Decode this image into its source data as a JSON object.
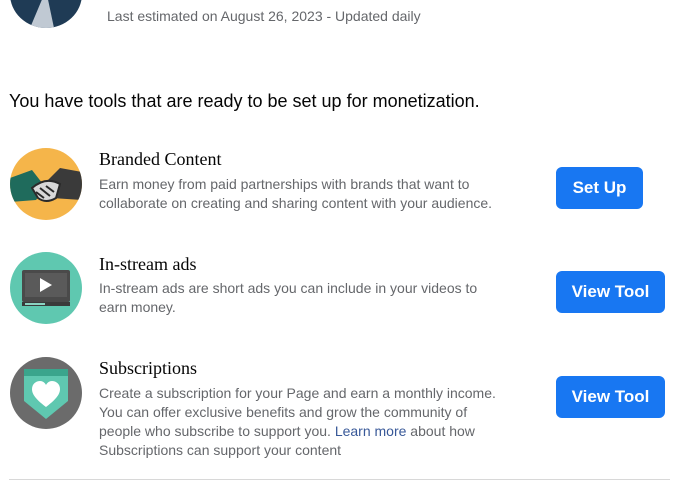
{
  "header": {
    "subtitle": "Last estimated on August 26, 2023 - Updated daily"
  },
  "intro_text": "You have tools that are ready to be set up for monetization.",
  "tools": [
    {
      "title": "Branded Content",
      "description": "Earn money from paid partnerships with brands that want to collaborate on creating and sharing content with your audience.",
      "button": "Set Up",
      "icon": "handshake-icon",
      "icon_bg": "#f5b54a"
    },
    {
      "title": "In-stream ads",
      "description": "In-stream ads are short ads you can include in your videos to earn money.",
      "button": "View Tool",
      "icon": "video-player-icon",
      "icon_bg": "#5fc8b0"
    },
    {
      "title": "Subscriptions",
      "description_before_link": "Create a subscription for your Page and earn a monthly income. You can offer exclusive benefits and grow the community of people who subscribe to support you. ",
      "link_text": "Learn more",
      "description_after_link": " about how Subscriptions can support your content",
      "button": "View Tool",
      "icon": "heart-shield-icon",
      "icon_bg": "#6b6b6b"
    }
  ],
  "colors": {
    "primary_button": "#1877f2",
    "link": "#385898",
    "secondary_text": "#65676b"
  }
}
